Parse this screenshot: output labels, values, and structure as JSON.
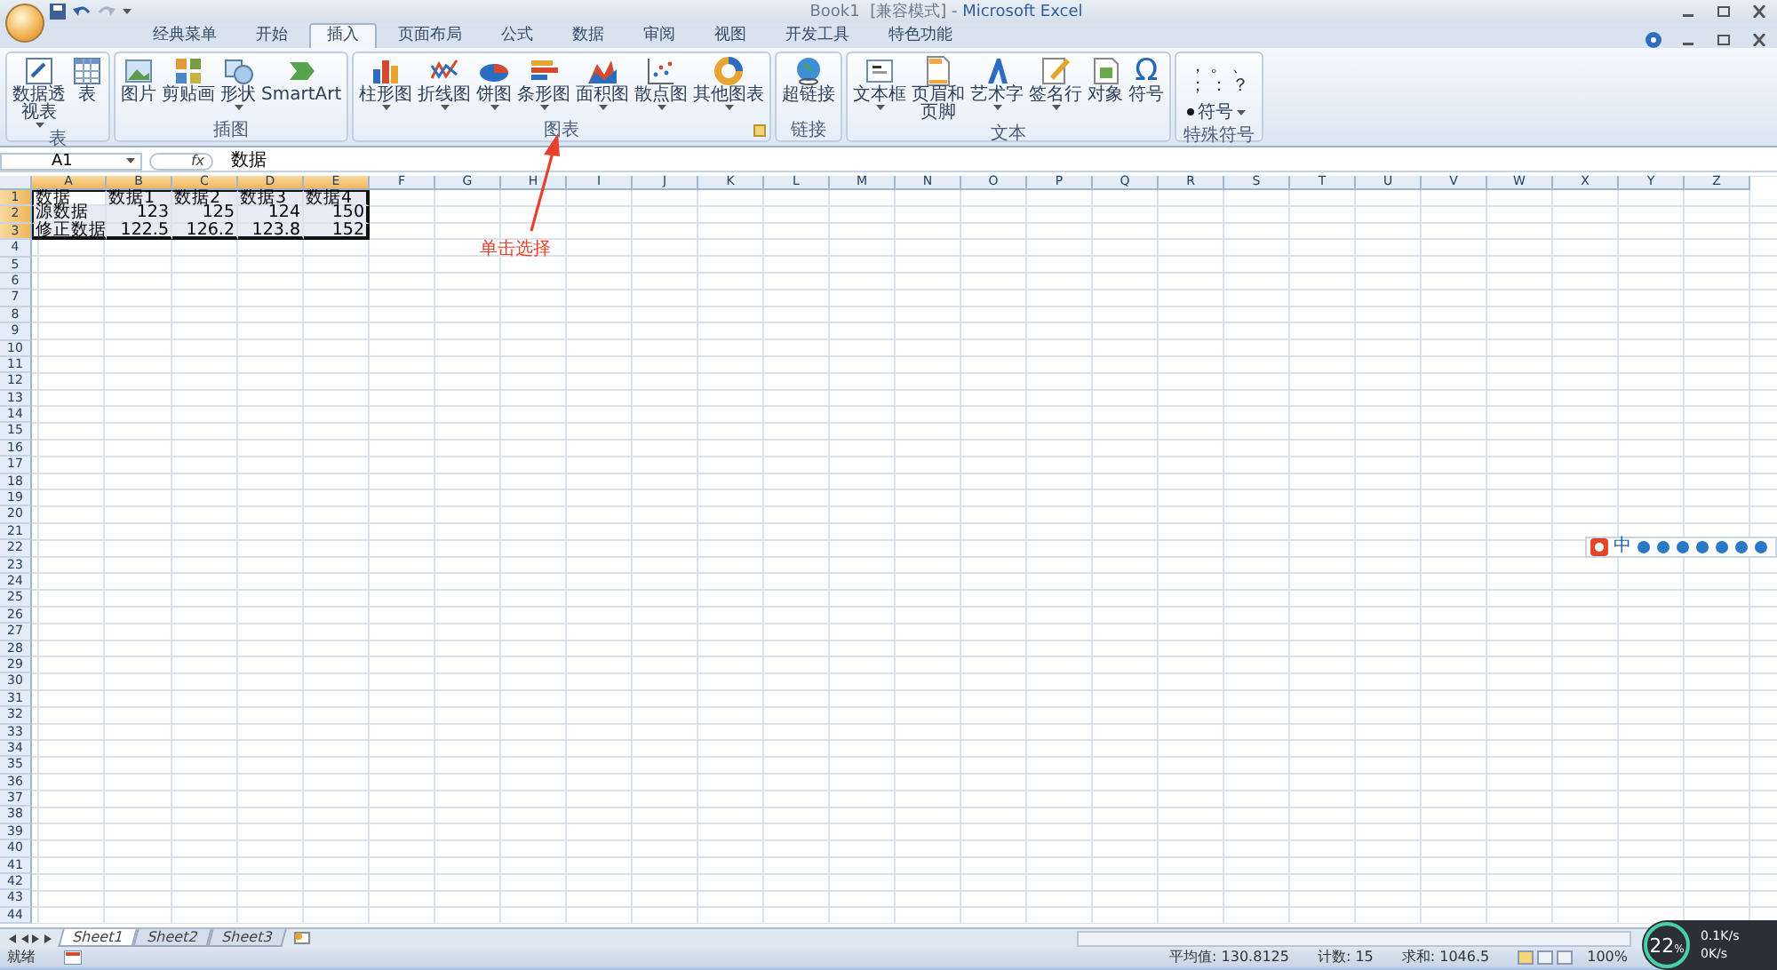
{
  "title_bar": {
    "document": "Book1  [兼容模式] - ",
    "app": "Microsoft Excel"
  },
  "ribbon_tabs": [
    {
      "label": "经典菜单",
      "selected": false
    },
    {
      "label": "开始",
      "selected": false
    },
    {
      "label": "插入",
      "selected": true
    },
    {
      "label": "页面布局",
      "selected": false
    },
    {
      "label": "公式",
      "selected": false
    },
    {
      "label": "数据",
      "selected": false
    },
    {
      "label": "审阅",
      "selected": false
    },
    {
      "label": "视图",
      "selected": false
    },
    {
      "label": "开发工具",
      "selected": false
    },
    {
      "label": "特色功能",
      "selected": false
    }
  ],
  "ribbon_groups": [
    {
      "label": "表",
      "launcher": false,
      "items": [
        {
          "label": "数据透视表",
          "dropdown": true
        },
        {
          "label": "表",
          "dropdown": false
        }
      ]
    },
    {
      "label": "插图",
      "launcher": false,
      "items": [
        {
          "label": "图片",
          "dropdown": false
        },
        {
          "label": "剪贴画",
          "dropdown": false
        },
        {
          "label": "形状",
          "dropdown": true
        },
        {
          "label": "SmartArt",
          "dropdown": false
        }
      ]
    },
    {
      "label": "图表",
      "launcher": true,
      "items": [
        {
          "label": "柱形图",
          "dropdown": true
        },
        {
          "label": "折线图",
          "dropdown": true
        },
        {
          "label": "饼图",
          "dropdown": true
        },
        {
          "label": "条形图",
          "dropdown": true
        },
        {
          "label": "面积图",
          "dropdown": true
        },
        {
          "label": "散点图",
          "dropdown": true
        },
        {
          "label": "其他图表",
          "dropdown": true
        }
      ]
    },
    {
      "label": "链接",
      "launcher": false,
      "items": [
        {
          "label": "超链接",
          "dropdown": false
        }
      ]
    },
    {
      "label": "文本",
      "launcher": false,
      "items": [
        {
          "label": "文本框",
          "dropdown": true
        },
        {
          "label": "页眉和页脚",
          "dropdown": false
        },
        {
          "label": "艺术字",
          "dropdown": true
        },
        {
          "label": "签名行",
          "dropdown": true
        },
        {
          "label": "对象",
          "dropdown": false
        },
        {
          "label": "符号",
          "dropdown": false,
          "icon_char": "Ω"
        }
      ]
    }
  ],
  "special_symbols": {
    "label": "特殊符号",
    "symbols": [
      "，",
      "。",
      "、",
      "；",
      "：",
      "？"
    ],
    "button": "符号"
  },
  "formula_bar": {
    "name_box": "A1",
    "fx": "fx",
    "value": "数据"
  },
  "columns": [
    {
      "label": "A",
      "selected": true
    },
    {
      "label": "B",
      "selected": true
    },
    {
      "label": "C",
      "selected": true
    },
    {
      "label": "D",
      "selected": true
    },
    {
      "label": "E",
      "selected": true
    },
    {
      "label": "F",
      "selected": false
    },
    {
      "label": "G",
      "selected": false
    },
    {
      "label": "H",
      "selected": false
    },
    {
      "label": "I",
      "selected": false
    },
    {
      "label": "J",
      "selected": false
    },
    {
      "label": "K",
      "selected": false
    },
    {
      "label": "L",
      "selected": false
    },
    {
      "label": "M",
      "selected": false
    },
    {
      "label": "N",
      "selected": false
    },
    {
      "label": "O",
      "selected": false
    },
    {
      "label": "P",
      "selected": false
    },
    {
      "label": "Q",
      "selected": false
    },
    {
      "label": "R",
      "selected": false
    },
    {
      "label": "S",
      "selected": false
    },
    {
      "label": "T",
      "selected": false
    },
    {
      "label": "U",
      "selected": false
    },
    {
      "label": "V",
      "selected": false
    },
    {
      "label": "W",
      "selected": false
    },
    {
      "label": "X",
      "selected": false
    },
    {
      "label": "Y",
      "selected": false
    },
    {
      "label": "Z",
      "selected": false
    }
  ],
  "rows": [
    {
      "header": "1",
      "selected": true,
      "cells": [
        {
          "value": "数据",
          "kind": "text",
          "selected": true,
          "active": true
        },
        {
          "value": "数据1",
          "kind": "text",
          "selected": true,
          "active": false
        },
        {
          "value": "数据2",
          "kind": "text",
          "selected": true,
          "active": false
        },
        {
          "value": "数据3",
          "kind": "text",
          "selected": true,
          "active": false
        },
        {
          "value": "数据4",
          "kind": "text",
          "selected": true,
          "active": false
        }
      ]
    },
    {
      "header": "2",
      "selected": true,
      "cells": [
        {
          "value": "源数据",
          "kind": "text",
          "selected": true,
          "active": false
        },
        {
          "value": "123",
          "kind": "number",
          "selected": true,
          "active": false
        },
        {
          "value": "125",
          "kind": "number",
          "selected": true,
          "active": false
        },
        {
          "value": "124",
          "kind": "number",
          "selected": true,
          "active": false
        },
        {
          "value": "150",
          "kind": "number",
          "selected": true,
          "active": false
        }
      ]
    },
    {
      "header": "3",
      "selected": true,
      "cells": [
        {
          "value": "修正数据",
          "kind": "text",
          "selected": true,
          "active": false
        },
        {
          "value": "122.5",
          "kind": "number",
          "selected": true,
          "active": false
        },
        {
          "value": "126.2",
          "kind": "number",
          "selected": true,
          "active": false
        },
        {
          "value": "123.8",
          "kind": "number",
          "selected": true,
          "active": false
        },
        {
          "value": "152",
          "kind": "number",
          "selected": true,
          "active": false
        }
      ]
    },
    {
      "header": "4",
      "selected": false
    },
    {
      "header": "5",
      "selected": false
    },
    {
      "header": "6",
      "selected": false
    },
    {
      "header": "7",
      "selected": false
    },
    {
      "header": "8",
      "selected": false
    },
    {
      "header": "9",
      "selected": false
    },
    {
      "header": "10",
      "selected": false
    },
    {
      "header": "11",
      "selected": false
    },
    {
      "header": "12",
      "selected": false
    },
    {
      "header": "13",
      "selected": false
    },
    {
      "header": "14",
      "selected": false
    },
    {
      "header": "15",
      "selected": false
    },
    {
      "header": "16",
      "selected": false
    },
    {
      "header": "17",
      "selected": false
    },
    {
      "header": "18",
      "selected": false
    },
    {
      "header": "19",
      "selected": false
    },
    {
      "header": "20",
      "selected": false
    },
    {
      "header": "21",
      "selected": false
    },
    {
      "header": "22",
      "selected": false
    },
    {
      "header": "23",
      "selected": false
    },
    {
      "header": "24",
      "selected": false
    },
    {
      "header": "25",
      "selected": false
    },
    {
      "header": "26",
      "selected": false
    },
    {
      "header": "27",
      "selected": false
    },
    {
      "header": "28",
      "selected": false
    },
    {
      "header": "29",
      "selected": false
    },
    {
      "header": "30",
      "selected": false
    },
    {
      "header": "31",
      "selected": false
    },
    {
      "header": "32",
      "selected": false
    },
    {
      "header": "33",
      "selected": false
    },
    {
      "header": "34",
      "selected": false
    },
    {
      "header": "35",
      "selected": false
    },
    {
      "header": "36",
      "selected": false
    },
    {
      "header": "37",
      "selected": false
    },
    {
      "header": "38",
      "selected": false
    },
    {
      "header": "39",
      "selected": false
    },
    {
      "header": "40",
      "selected": false
    },
    {
      "header": "41",
      "selected": false
    },
    {
      "header": "42",
      "selected": false
    },
    {
      "header": "43",
      "selected": false
    },
    {
      "header": "44",
      "selected": false
    }
  ],
  "annotation": {
    "text": "单击选择"
  },
  "sheet_tabs": [
    {
      "label": "Sheet1",
      "selected": true
    },
    {
      "label": "Sheet2",
      "selected": false
    },
    {
      "label": "Sheet3",
      "selected": false
    }
  ],
  "status_bar": {
    "mode": "就绪",
    "stats": [
      "平均值: 130.8125",
      "计数: 15",
      "求和: 1046.5"
    ],
    "views": [
      {
        "selected": true
      },
      {
        "selected": false
      },
      {
        "selected": false
      }
    ],
    "zoom": "100%"
  },
  "ime_toolbar": {
    "mode": "中"
  },
  "net_meter": {
    "percent": "22",
    "unit": "%",
    "up": "0.1K/s",
    "down": "0K/s"
  }
}
